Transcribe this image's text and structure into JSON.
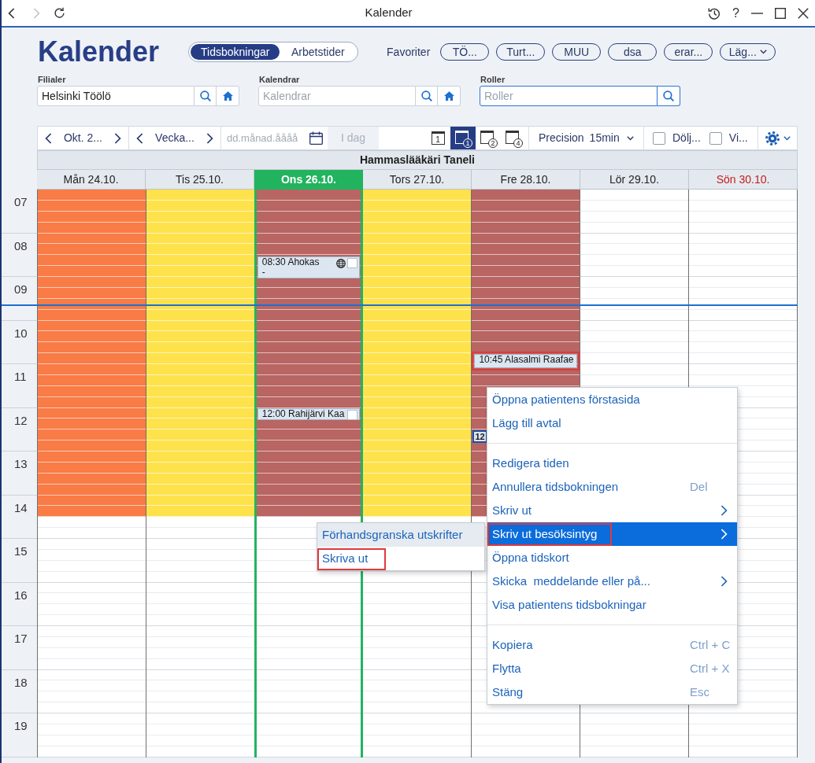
{
  "window": {
    "title": "Kalender",
    "help": "?"
  },
  "header": {
    "title": "Kalender",
    "tabs": [
      {
        "label": "Tidsbokningar",
        "selected": true
      },
      {
        "label": "Arbetstider",
        "selected": false
      }
    ],
    "favorites_label": "Favoriter",
    "favorites": [
      {
        "label": "TÖ...",
        "kind": "pill"
      },
      {
        "label": "Turt...",
        "kind": "pill"
      },
      {
        "label": "MUU",
        "kind": "pill"
      },
      {
        "label": "dsa",
        "kind": "pill"
      },
      {
        "label": "erar...",
        "kind": "pill"
      },
      {
        "label": "Läg...",
        "kind": "dropdown"
      }
    ]
  },
  "filters": [
    {
      "label": "Filialer",
      "value": "Helsinki Töölö",
      "kind": "search-home",
      "focused": false
    },
    {
      "label": "Kalendrar",
      "placeholder": "Kalendrar",
      "kind": "search-home",
      "focused": false
    },
    {
      "label": "Roller",
      "placeholder": "Roller",
      "kind": "search",
      "focused": true
    }
  ],
  "toolbar": {
    "month": "Okt. 2...",
    "week": "Vecka...",
    "date_field": {
      "placeholder": "dd.månad.åååå"
    },
    "today_button": {
      "label": "I dag",
      "disabled": true
    },
    "views": [
      {
        "label": "1",
        "kind": "plain",
        "selected": false
      },
      {
        "label": "1",
        "kind": "circled",
        "selected": true
      },
      {
        "label": "2",
        "kind": "circled",
        "selected": false
      },
      {
        "label": "4",
        "kind": "circled",
        "selected": false
      }
    ],
    "precision_label": "Precision",
    "precision_value": "15min",
    "checkboxes": [
      {
        "label": "Dölj...",
        "checked": false
      },
      {
        "label": "Vi...",
        "checked": false
      }
    ]
  },
  "calendar": {
    "title": "Hammaslääkäri Taneli",
    "hours": [
      "07",
      "08",
      "09",
      "10",
      "11",
      "12",
      "13",
      "14",
      "15",
      "16",
      "17",
      "18",
      "19"
    ],
    "days": [
      {
        "label": "Mån 24.10.",
        "color": "#f97b46",
        "today": false,
        "holiday": false
      },
      {
        "label": "Tis 25.10.",
        "color": "#fee24c",
        "today": false,
        "holiday": false
      },
      {
        "label": "Ons 26.10.",
        "color": "#b86563",
        "today": true,
        "holiday": false,
        "events": [
          {
            "label": "08:30 Ahokas",
            "note": "-",
            "globe": true,
            "checked": false,
            "selected": false,
            "annotated": false
          },
          {
            "label": "12:00 Rahijärvi Kaa",
            "globe": false,
            "checked": false,
            "selected": false,
            "annotated": false
          }
        ]
      },
      {
        "label": "Tors 27.10.",
        "color": "#fee24c",
        "today": false,
        "holiday": false
      },
      {
        "label": "Fre 28.10.",
        "color": "#b86563",
        "today": false,
        "holiday": false,
        "events": [
          {
            "label": "10:45 Alasalmi Raafae",
            "globe": false,
            "selected": false,
            "annotated": true
          },
          {
            "label": "12",
            "globe": false,
            "selected": true,
            "annotated": false
          }
        ]
      },
      {
        "label": "Lör 29.10.",
        "today": false,
        "holiday": false
      },
      {
        "label": "Sön 30.10.",
        "today": false,
        "holiday": true
      }
    ]
  },
  "context_menu": {
    "groups": [
      {
        "items": [
          {
            "label": "Öppna patientens förstasida",
            "has_submenu": false,
            "selected": false,
            "annotated": false
          },
          {
            "label": "Lägg till avtal",
            "has_submenu": false,
            "selected": false,
            "annotated": false
          }
        ]
      },
      {
        "items": [
          {
            "label": "Redigera tiden",
            "has_submenu": false,
            "selected": false,
            "annotated": false
          },
          {
            "label": "Annullera tidsbokningen",
            "shortcut": "Del",
            "has_submenu": false,
            "selected": false,
            "annotated": false
          },
          {
            "label": "Skriv ut",
            "has_submenu": true,
            "selected": false,
            "annotated": false
          },
          {
            "label": "Skriv ut besöksintyg",
            "has_submenu": true,
            "selected": true,
            "annotated": true
          },
          {
            "label": "Öppna tidskort",
            "has_submenu": false,
            "selected": false,
            "annotated": false
          },
          {
            "label": "Skicka  meddelande eller på...",
            "has_submenu": true,
            "selected": false,
            "annotated": false
          },
          {
            "label": "Visa patientens tidsbokningar",
            "has_submenu": false,
            "selected": false,
            "annotated": false
          }
        ]
      },
      {
        "items": [
          {
            "label": "Kopiera",
            "shortcut": "Ctrl + C",
            "has_submenu": false,
            "selected": false,
            "annotated": false
          },
          {
            "label": "Flytta",
            "shortcut": "Ctrl + X",
            "has_submenu": false,
            "selected": false,
            "annotated": false
          },
          {
            "label": "Stäng",
            "shortcut": "Esc",
            "has_submenu": false,
            "selected": false,
            "annotated": false
          }
        ]
      }
    ]
  },
  "submenu": {
    "items": [
      {
        "label": "Förhandsgranska utskrifter",
        "selected": true,
        "annotated": false
      },
      {
        "label": "Skriva ut",
        "selected": false,
        "annotated": true
      }
    ]
  }
}
